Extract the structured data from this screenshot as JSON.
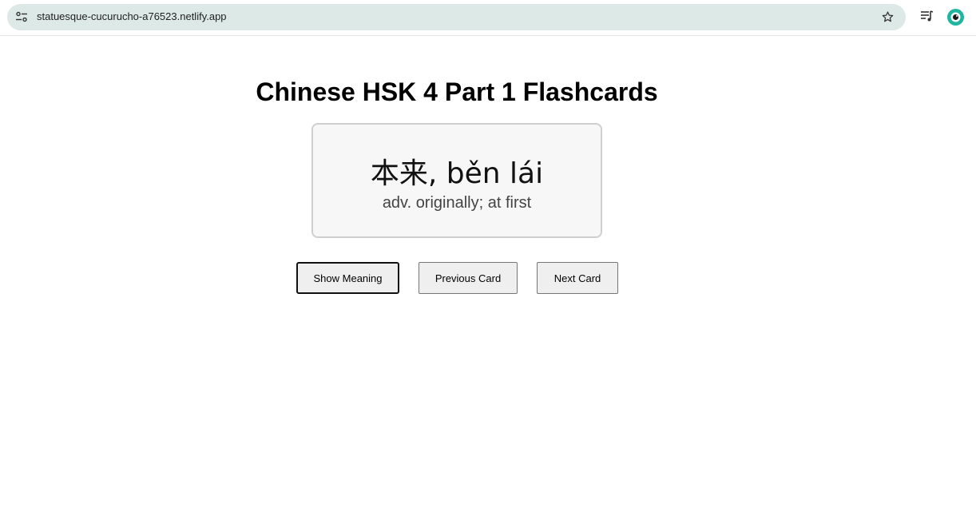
{
  "browser": {
    "url": "statuesque-cucurucho-a76523.netlify.app",
    "icons": {
      "site_info": "site-settings-icon",
      "bookmark": "star-icon",
      "media": "media-controls-icon",
      "profile": "profile-avatar-icon"
    },
    "accent_color": "#1fb5a0",
    "omnibox_color": "#dde9e6"
  },
  "page": {
    "title": "Chinese HSK 4 Part 1 Flashcards",
    "card": {
      "word": "本来, běn lái",
      "meaning": "adv. originally; at first"
    },
    "buttons": {
      "show_meaning": "Show Meaning",
      "previous": "Previous Card",
      "next": "Next Card"
    }
  }
}
